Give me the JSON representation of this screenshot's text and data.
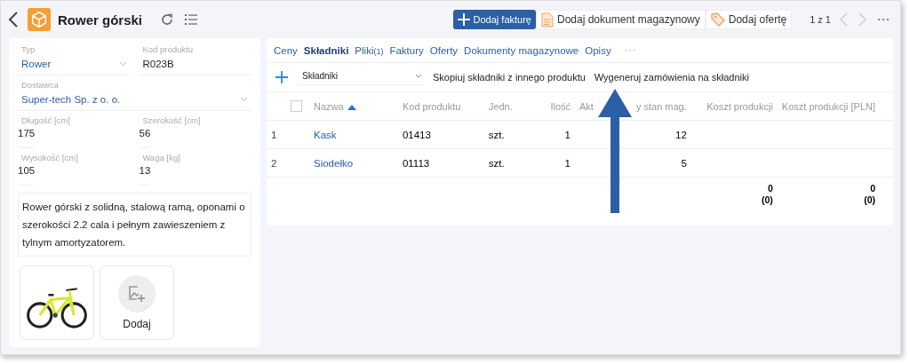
{
  "header": {
    "title": "Rower górski",
    "actions": [
      {
        "kind": "primary",
        "label": "Dodaj fakturę"
      },
      {
        "kind": "document",
        "label": "Dodaj dokument magazynowy"
      },
      {
        "kind": "tag",
        "label": "Dodaj ofertę"
      }
    ],
    "pager": "1 z 1"
  },
  "fields": [
    {
      "label": "Typ",
      "value": "Rower",
      "kind": "select"
    },
    {
      "label": "Kod produktu",
      "value": "R023B",
      "kind": "text"
    },
    {
      "label": "Dostawca",
      "value": "Super-tech Sp. z o. o.",
      "kind": "select"
    },
    {
      "label": "Długość [cm]",
      "value": "175",
      "kind": "number"
    },
    {
      "label": "Szerokość [cm]",
      "value": "56",
      "kind": "number"
    },
    {
      "label": "Wysokość [cm]",
      "value": "105",
      "kind": "number"
    },
    {
      "label": "Waga [kg]",
      "value": "13",
      "kind": "number"
    }
  ],
  "description": "Rower górski z solidną, stalową ramą, oponami o szerokości 2.2 cala i pełnym zawieszeniem z tylnym amortyzatorem.",
  "gallery": {
    "add_label": "Dodaj"
  },
  "tabs": [
    {
      "label": "Ceny",
      "selected": false
    },
    {
      "label": "Składniki",
      "selected": true
    },
    {
      "label": "Pliki",
      "count": "(1)",
      "selected": false
    },
    {
      "label": "Faktury",
      "selected": false
    },
    {
      "label": "Oferty",
      "selected": false
    },
    {
      "label": "Dokumenty magazynowe",
      "selected": false
    },
    {
      "label": "Opisy",
      "selected": false
    }
  ],
  "toolbar": {
    "select_value": "Składniki",
    "copy_label": "Skopiuj składniki z innego produktu",
    "generate_label": "Wygeneruj zamówienia na składniki"
  },
  "table": {
    "select_all_checked": false,
    "columns": [
      {
        "label": "Nazwa",
        "sorted": true
      },
      {
        "label": "Kod produktu"
      },
      {
        "label": "Jedn."
      },
      {
        "label": "Ilość"
      },
      {
        "label_parts": [
          "Akt",
          "y stan mag."
        ]
      },
      {
        "label": "Koszt produkcji"
      },
      {
        "label": "Koszt produkcji [PLN]"
      }
    ],
    "rows": [
      {
        "index": "1",
        "cells": [
          "Kask",
          "01413",
          "szt.",
          "1",
          "12",
          "",
          ""
        ]
      },
      {
        "index": "2",
        "cells": [
          "Siodełko",
          "01113",
          "szt.",
          "1",
          "5",
          "",
          ""
        ]
      }
    ],
    "totals": [
      {
        "value": "0",
        "sub": "(0)"
      },
      {
        "value": "0",
        "sub": "(0)"
      }
    ]
  }
}
